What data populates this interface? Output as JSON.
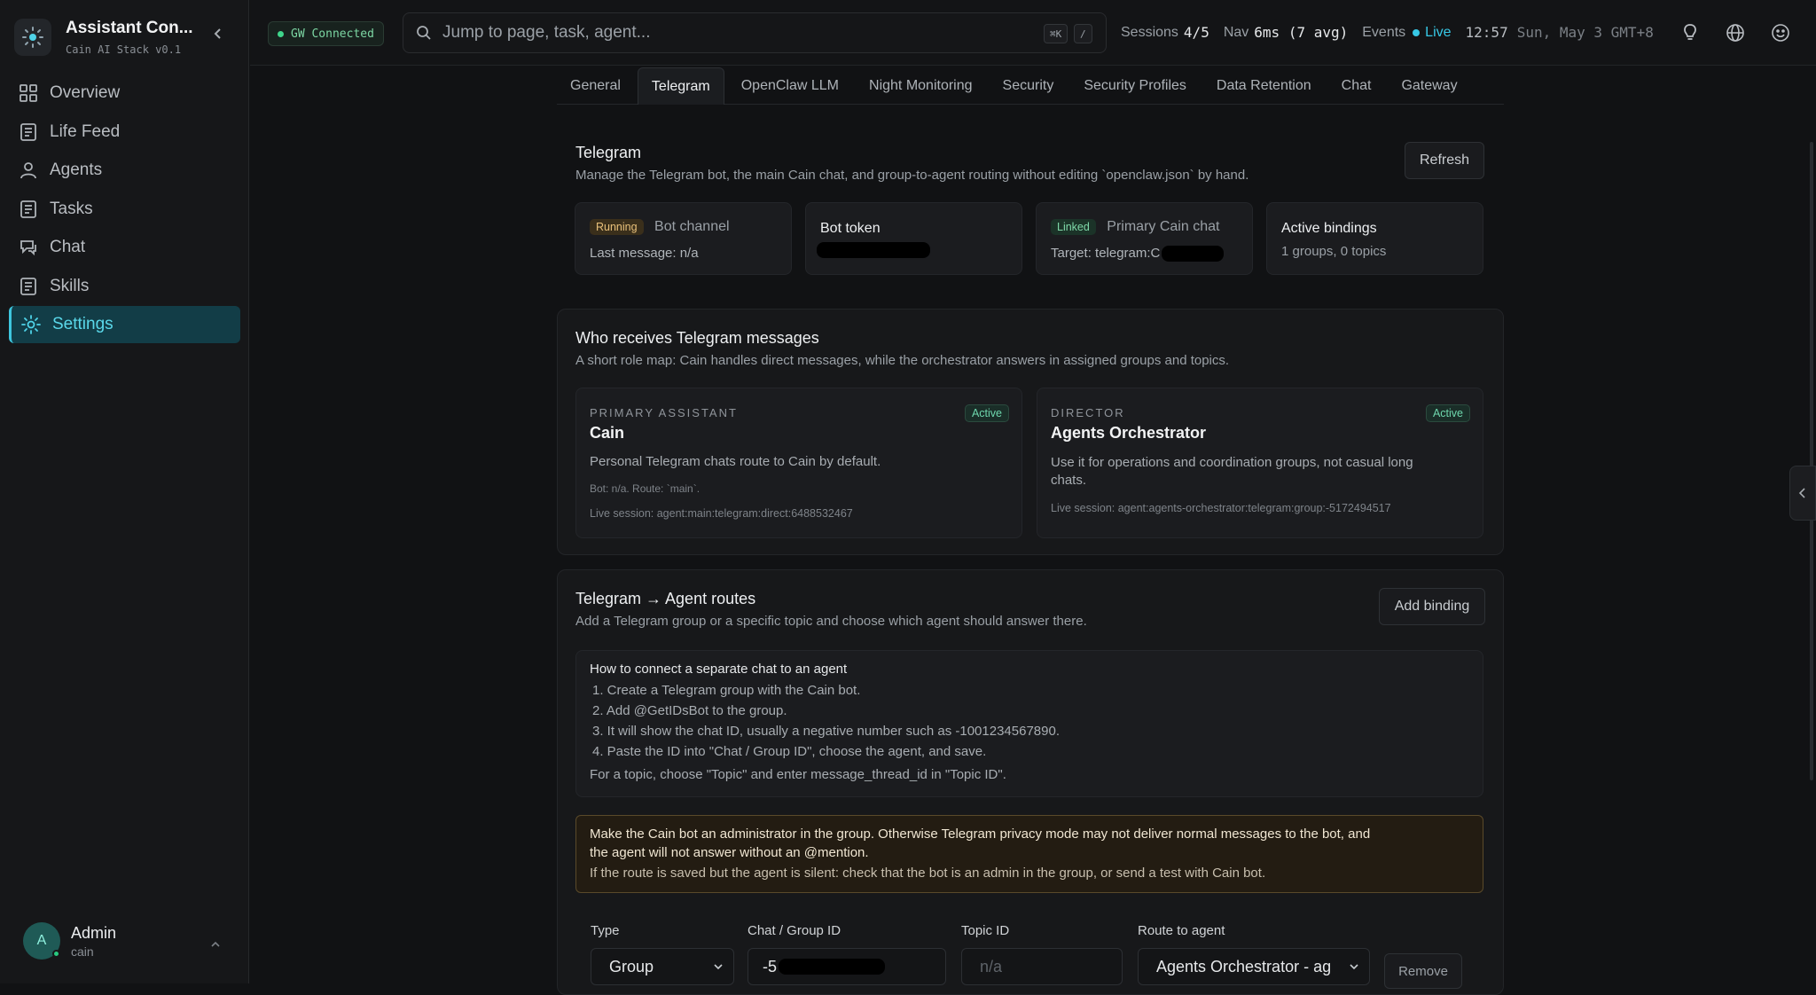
{
  "sidebar": {
    "title": "Assistant Con...",
    "subtitle": "Cain AI Stack v0.1",
    "items": [
      {
        "label": "Overview",
        "icon": "grid-icon"
      },
      {
        "label": "Life Feed",
        "icon": "document-icon"
      },
      {
        "label": "Agents",
        "icon": "user-icon"
      },
      {
        "label": "Tasks",
        "icon": "document-icon"
      },
      {
        "label": "Chat",
        "icon": "chat-icon"
      },
      {
        "label": "Skills",
        "icon": "document-icon"
      },
      {
        "label": "Settings",
        "icon": "gear-icon",
        "active": true
      }
    ],
    "user": {
      "initial": "A",
      "name": "Admin",
      "handle": "cain"
    }
  },
  "topbar": {
    "gw_status": "GW Connected",
    "search_placeholder": "Jump to page, task, agent...",
    "kbd1": "⌘K",
    "kbd2": "/",
    "sessions_label": "Sessions",
    "sessions_value": "4/5",
    "nav_label": "Nav",
    "nav_value": "6ms (7 avg)",
    "events_label": "Events",
    "events_value": "Live",
    "clock": "12:57",
    "date": "Sun, May 3 GMT+8"
  },
  "tabs": [
    "General",
    "Telegram",
    "OpenClaw LLM",
    "Night Monitoring",
    "Security",
    "Security Profiles",
    "Data Retention",
    "Chat",
    "Gateway"
  ],
  "telegram": {
    "title": "Telegram",
    "description": "Manage the Telegram bot, the main Cain chat, and group-to-agent routing without editing `openclaw.json` by hand.",
    "refresh_label": "Refresh",
    "status_cards": {
      "bot_channel": {
        "badge": "Running",
        "label": "Bot channel",
        "detail": "Last message: n/a"
      },
      "bot_token": {
        "label": "Bot token"
      },
      "primary_chat": {
        "badge": "Linked",
        "label": "Primary Cain chat",
        "detail": "Target: telegram:C"
      },
      "bindings": {
        "label": "Active bindings",
        "detail": "1 groups, 0 topics"
      }
    }
  },
  "receivers": {
    "title": "Who receives Telegram messages",
    "description": "A short role map: Cain handles direct messages, while the orchestrator answers in assigned groups and topics.",
    "primary": {
      "role": "PRIMARY ASSISTANT",
      "badge": "Active",
      "name": "Cain",
      "description": "Personal Telegram chats route to Cain by default.",
      "meta": "Bot: n/a. Route: `main`.",
      "session": "Live session: agent:main:telegram:direct:6488532467"
    },
    "director": {
      "role": "DIRECTOR",
      "badge": "Active",
      "name": "Agents Orchestrator",
      "description_line1": "Use it for operations and coordination groups, not casual long",
      "description_line2": "chats.",
      "session": "Live session: agent:agents-orchestrator:telegram:group:-5172494517"
    }
  },
  "routes": {
    "title": "Telegram → Agent routes",
    "description": "Add a Telegram group or a specific topic and choose which agent should answer there.",
    "add_label": "Add binding",
    "howto": {
      "title": "How to connect a separate chat to an agent",
      "steps": [
        "1. Create a Telegram group with the Cain bot.",
        "2. Add @GetIDsBot to the group.",
        "3. It will show the chat ID, usually a negative number such as -1001234567890.",
        "4. Paste the ID into \"Chat / Group ID\", choose the agent, and save."
      ],
      "topic_note": "For a topic, choose \"Topic\" and enter message_thread_id in \"Topic ID\"."
    },
    "warning_line1": "Make the Cain bot an administrator in the group. Otherwise Telegram privacy mode may not deliver normal messages to the bot, and",
    "warning_line2": "the agent will not answer without an @mention.",
    "warning_note": "If the route is saved but the agent is silent: check that the bot is an admin in the group, or send a test with Cain bot.",
    "form": {
      "type_label": "Type",
      "type_value": "Group",
      "chat_label": "Chat / Group ID",
      "chat_value": "-5",
      "topic_label": "Topic ID",
      "topic_placeholder": "n/a",
      "agent_label": "Route to agent",
      "agent_value": "Agents Orchestrator - ag",
      "remove_label": "Remove"
    }
  }
}
